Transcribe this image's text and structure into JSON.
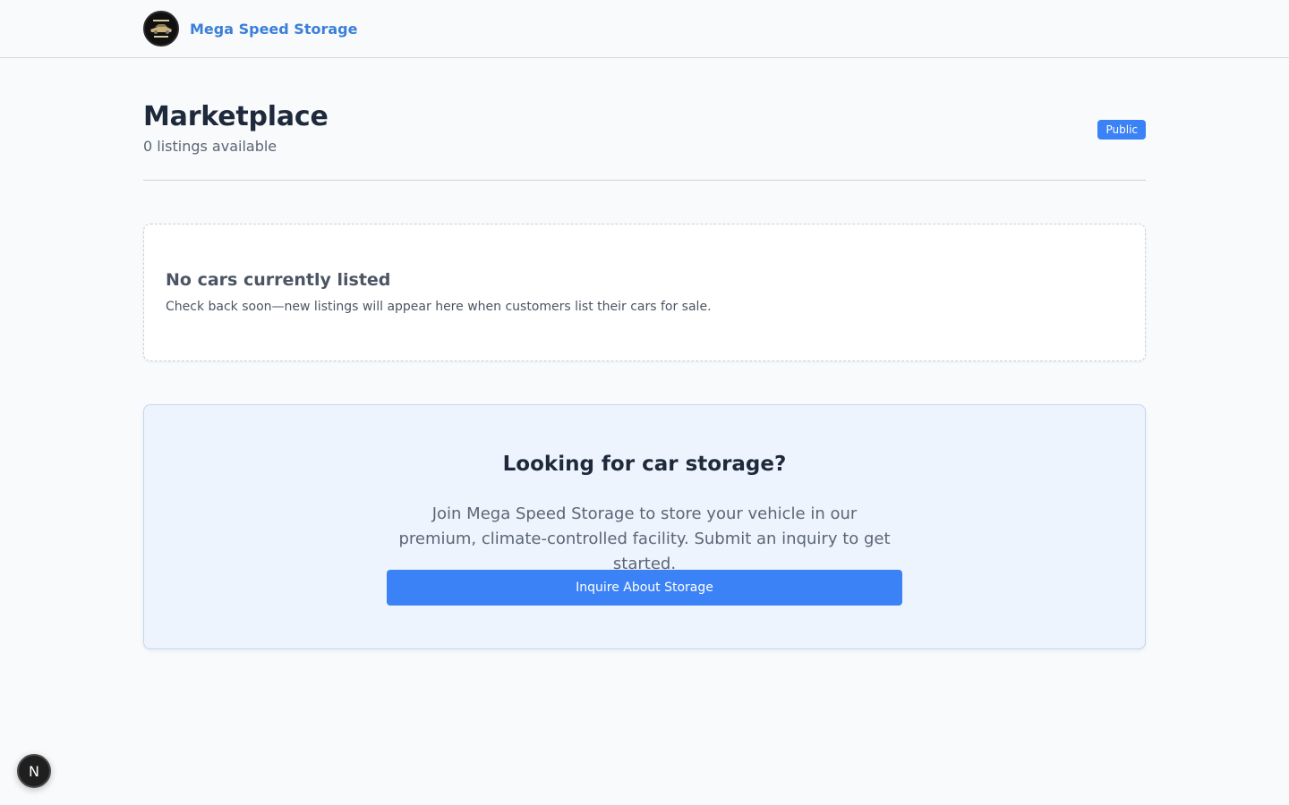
{
  "header": {
    "brand_name": "Mega Speed Storage",
    "logo_icon": "mega-speed-storage-logo"
  },
  "page": {
    "title": "Marketplace",
    "subtitle": "0 listings available",
    "badge": "Public"
  },
  "empty_state": {
    "title": "No cars currently listed",
    "text": "Check back soon—new listings will appear here when customers list their cars for sale."
  },
  "cta": {
    "title": "Looking for car storage?",
    "text": "Join Mega Speed Storage to store your vehicle in our premium, climate-controlled facility. Submit an inquiry to get started.",
    "button_label": "Inquire About Storage"
  },
  "dev_badge": {
    "label": "N"
  },
  "colors": {
    "accent": "#3b82f6",
    "brand_text": "#3b7fd8",
    "background": "#f8fafc",
    "cta_background": "#eef4fd"
  }
}
